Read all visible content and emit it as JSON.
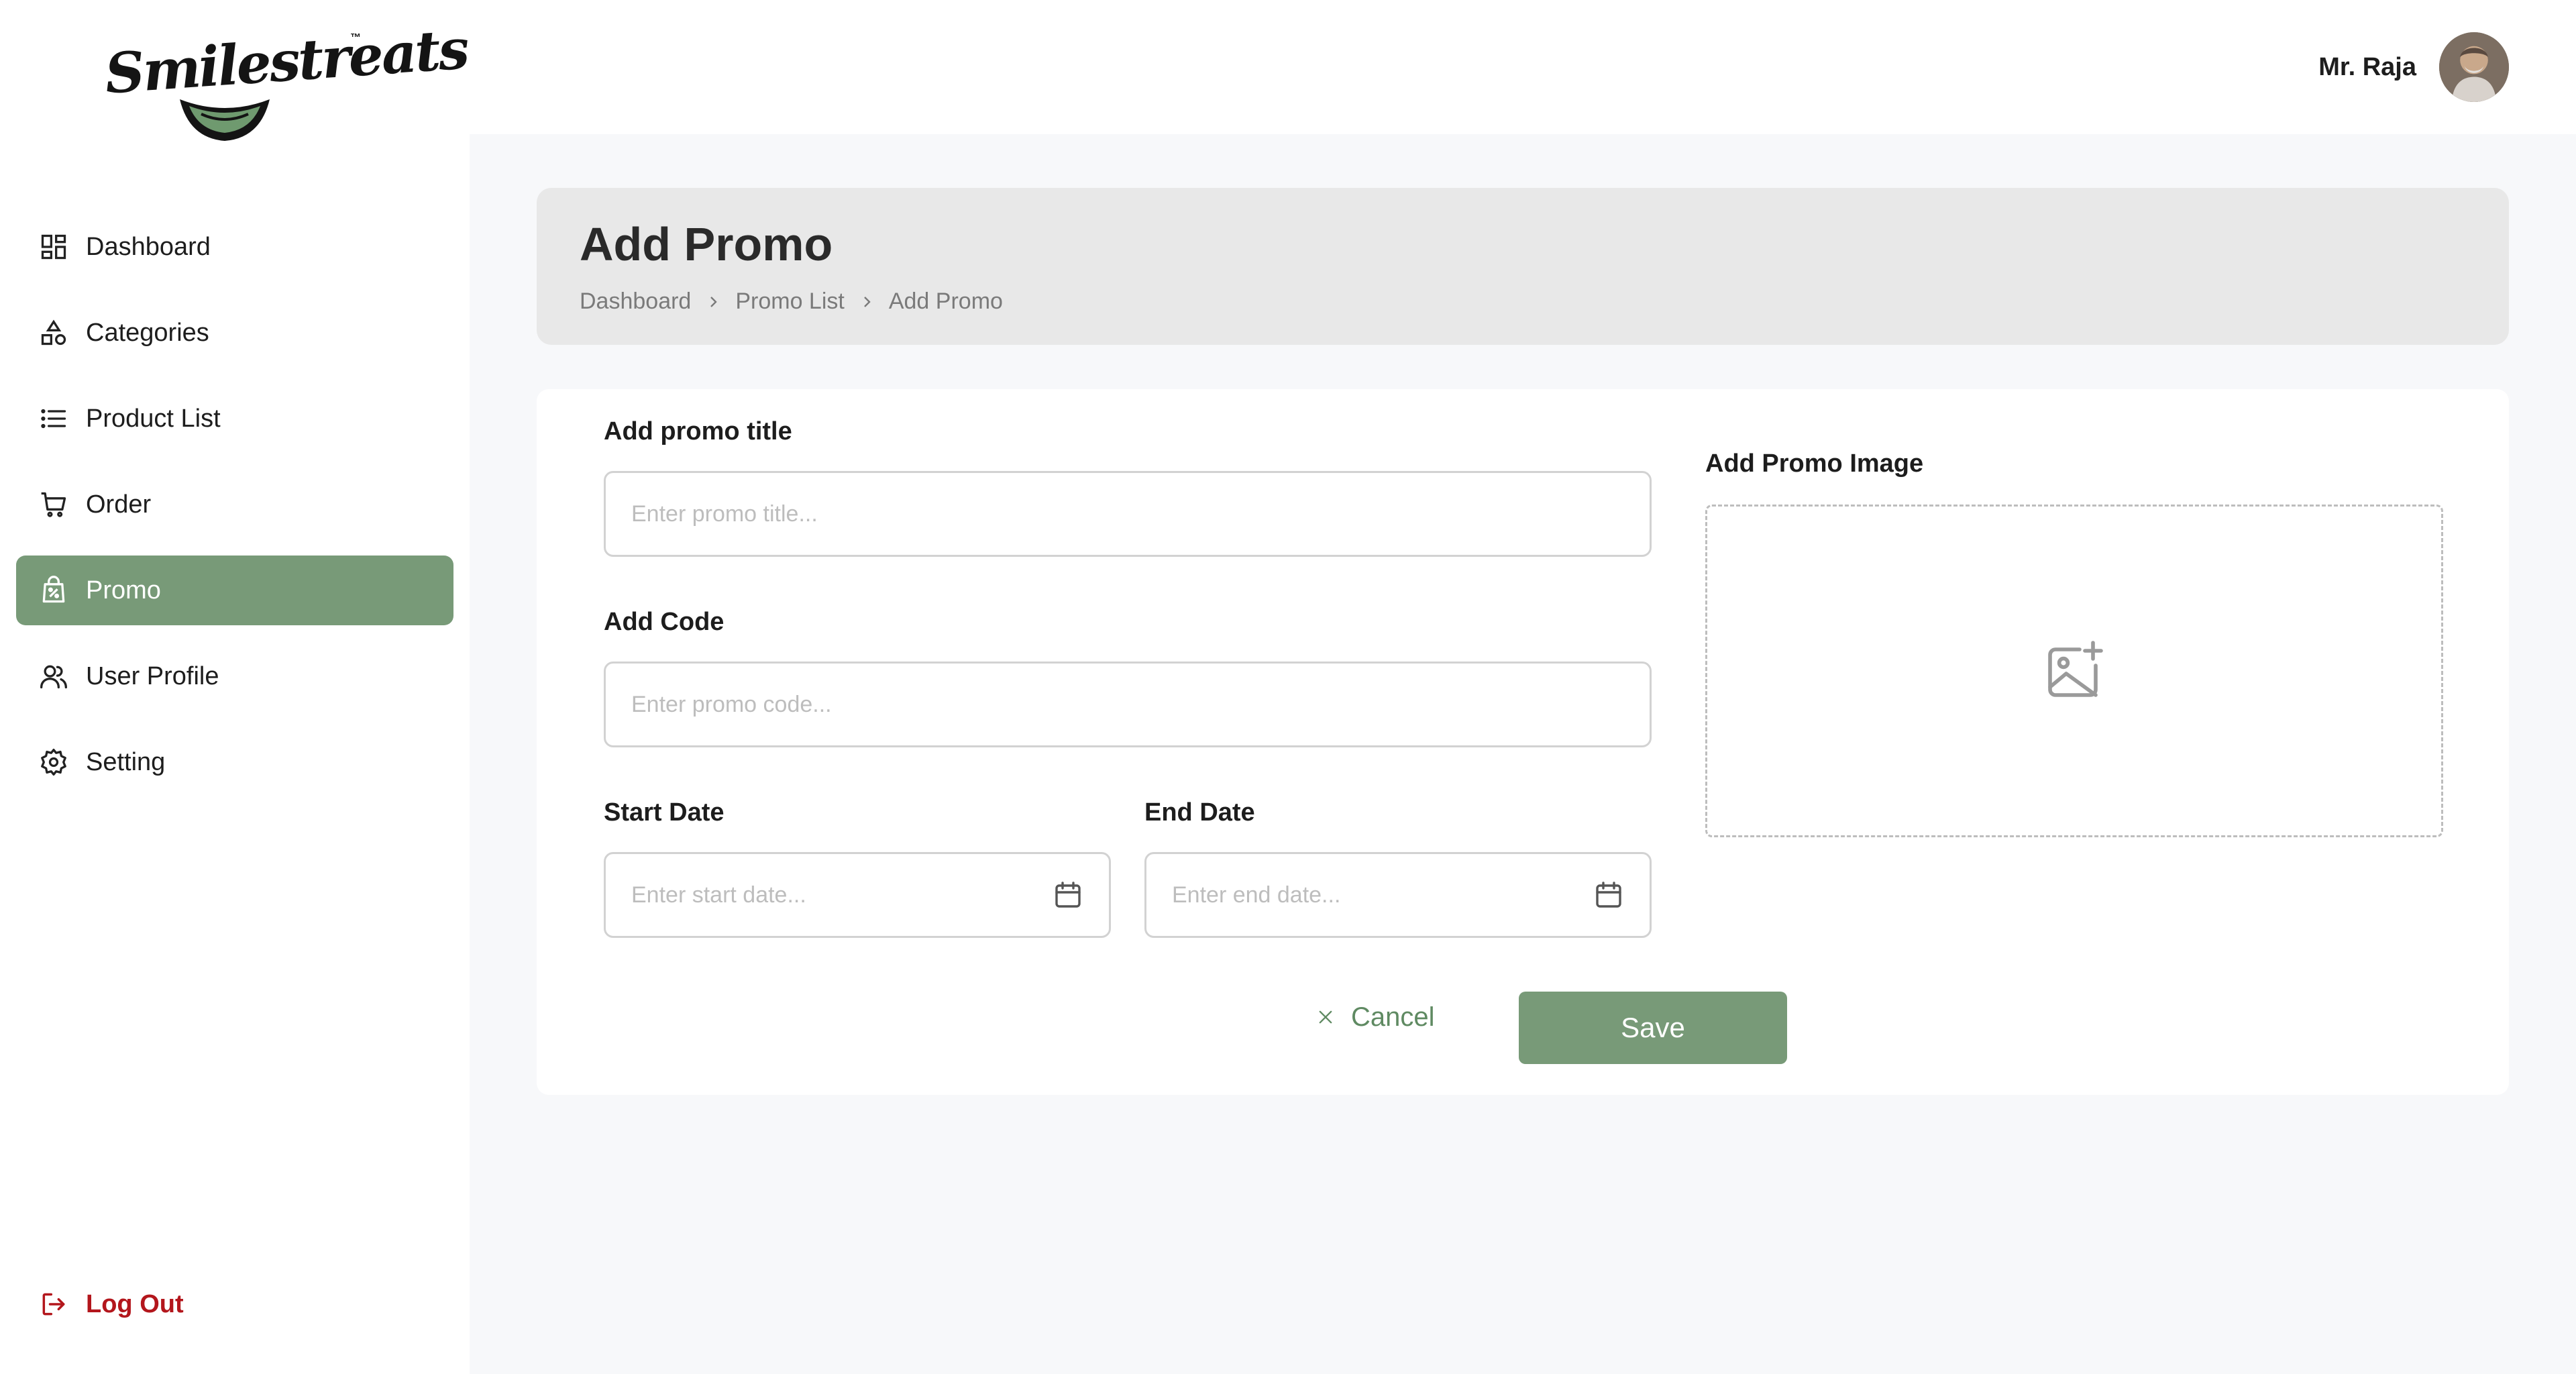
{
  "brand": {
    "name": "Smilestreats",
    "trademark": "™",
    "accent_color": "#789a78",
    "danger_color": "#b3161c"
  },
  "sidebar": {
    "items": [
      {
        "label": "Dashboard",
        "icon": "dashboard-grid-icon",
        "active": false
      },
      {
        "label": "Categories",
        "icon": "shapes-icon",
        "active": false
      },
      {
        "label": "Product List",
        "icon": "list-icon",
        "active": false
      },
      {
        "label": "Order",
        "icon": "cart-icon",
        "active": false
      },
      {
        "label": "Promo",
        "icon": "promo-bag-icon",
        "active": true
      },
      {
        "label": "User Profile",
        "icon": "users-icon",
        "active": false
      },
      {
        "label": "Setting",
        "icon": "gear-icon",
        "active": false
      }
    ],
    "logout": {
      "label": "Log Out",
      "icon": "logout-icon"
    }
  },
  "header": {
    "user_name": "Mr. Raja"
  },
  "page": {
    "title": "Add Promo",
    "breadcrumb": [
      "Dashboard",
      "Promo List",
      "Add Promo"
    ]
  },
  "form": {
    "promo_title": {
      "label": "Add promo title",
      "placeholder": "Enter promo title...",
      "value": ""
    },
    "code": {
      "label": "Add Code",
      "placeholder": "Enter promo code...",
      "value": ""
    },
    "start_date": {
      "label": "Start Date",
      "placeholder": "Enter start date...",
      "value": ""
    },
    "end_date": {
      "label": "End Date",
      "placeholder": "Enter end date...",
      "value": ""
    },
    "image": {
      "label": "Add Promo Image",
      "icon": "add-image-icon"
    },
    "cancel_label": "Cancel",
    "save_label": "Save"
  }
}
